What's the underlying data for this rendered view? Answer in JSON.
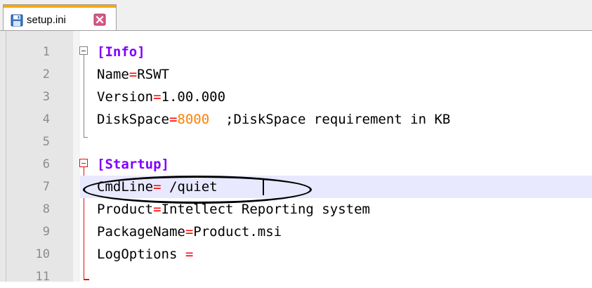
{
  "tab": {
    "filename": "setup.ini",
    "save_icon": "floppy-disk-icon",
    "close_icon": "close-x-icon"
  },
  "lines": [
    {
      "num": "1",
      "key": "[Info]"
    },
    {
      "num": "2",
      "key": "Name",
      "op": "=",
      "value": "RSWT"
    },
    {
      "num": "3",
      "key": "Version",
      "op": "=",
      "value": "1.00.000"
    },
    {
      "num": "4",
      "key": "DiskSpace",
      "op": "=",
      "value": "8000",
      "comment": "  ;DiskSpace requirement in KB"
    },
    {
      "num": "5"
    },
    {
      "num": "6",
      "key": "[Startup]"
    },
    {
      "num": "7",
      "key": "CmdLine",
      "op": "=",
      "value": " /quiet"
    },
    {
      "num": "8",
      "key": "Product",
      "op": "=",
      "value": "Intellect Reporting system"
    },
    {
      "num": "9",
      "key": "PackageName",
      "op": "=",
      "value": "Product.msi"
    },
    {
      "num": "10",
      "key": "LogOptions ",
      "op": "="
    },
    {
      "num": "11"
    }
  ],
  "colors": {
    "section": "#8000ff",
    "operator": "#ff0000",
    "number": "#ff8000",
    "tab_accent": "#f9a800",
    "current_line": "#e8e8ff"
  }
}
